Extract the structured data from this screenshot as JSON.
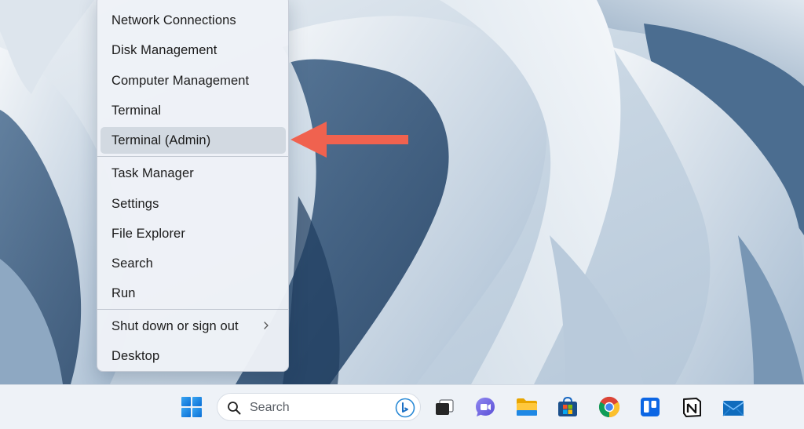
{
  "context_menu": {
    "items": [
      {
        "label": "Network Connections"
      },
      {
        "label": "Disk Management"
      },
      {
        "label": "Computer Management"
      },
      {
        "label": "Terminal"
      },
      {
        "label": "Terminal (Admin)"
      },
      {
        "label": "Task Manager"
      },
      {
        "label": "Settings"
      },
      {
        "label": "File Explorer"
      },
      {
        "label": "Search"
      },
      {
        "label": "Run"
      },
      {
        "label": "Shut down or sign out"
      },
      {
        "label": "Desktop"
      }
    ],
    "highlighted_item": "Terminal (Admin)"
  },
  "annotation": {
    "arrow_color": "#f0624f"
  },
  "taskbar": {
    "search_placeholder": "Search",
    "pinned_apps": [
      "start-button",
      "search",
      "task-view",
      "chat",
      "file-explorer",
      "microsoft-store",
      "chrome",
      "trello",
      "notion",
      "mail"
    ]
  },
  "colors": {
    "accent_blue": "#0a6fd6",
    "menu_background": "#eef2f7",
    "taskbar_background": "#eef2f7"
  }
}
